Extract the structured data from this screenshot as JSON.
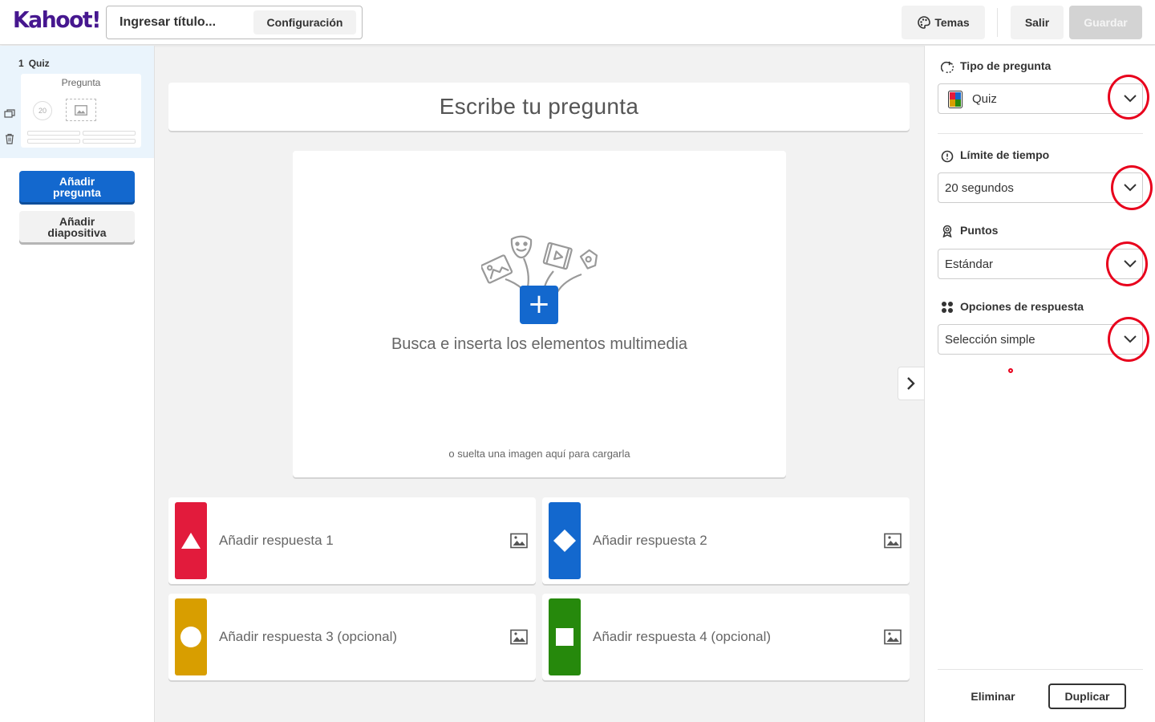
{
  "header": {
    "logo_text": "Kahoot",
    "logo_bang": "!",
    "title_placeholder": "Ingresar título...",
    "config_label": "Configuración",
    "themes_label": "Temas",
    "exit_label": "Salir",
    "save_label": "Guardar"
  },
  "sidebar": {
    "slide": {
      "number": "1",
      "type": "Quiz",
      "thumb_title": "Pregunta",
      "thumb_timer": "20"
    },
    "add_question_label": [
      "Añadir",
      "pregunta"
    ],
    "add_slide_label": [
      "Añadir",
      "diapositiva"
    ]
  },
  "editor": {
    "question_placeholder": "Escribe tu pregunta",
    "media_text": "Busca e inserta los elementos multimedia",
    "media_subtext": "o suelta una imagen aquí para cargarla",
    "answers": [
      {
        "label": "Añadir respuesta 1",
        "color": "#e21b3c",
        "shape": "triangle"
      },
      {
        "label": "Añadir respuesta 2",
        "color": "#1368ce",
        "shape": "diamond"
      },
      {
        "label": "Añadir respuesta 3 (opcional)",
        "color": "#d89e00",
        "shape": "circle"
      },
      {
        "label": "Añadir respuesta 4 (opcional)",
        "color": "#26890c",
        "shape": "square"
      }
    ]
  },
  "settings": {
    "question_type": {
      "label": "Tipo de pregunta",
      "value": "Quiz"
    },
    "time_limit": {
      "label": "Límite de tiempo",
      "value": "20 segundos"
    },
    "points": {
      "label": "Puntos",
      "value": "Estándar"
    },
    "answer_options": {
      "label": "Opciones de respuesta",
      "value": "Selección simple"
    },
    "delete_label": "Eliminar",
    "duplicate_label": "Duplicar"
  },
  "colors": {
    "brand": "#46178f",
    "primary": "#1368ce",
    "annotation": "#e8001c"
  }
}
